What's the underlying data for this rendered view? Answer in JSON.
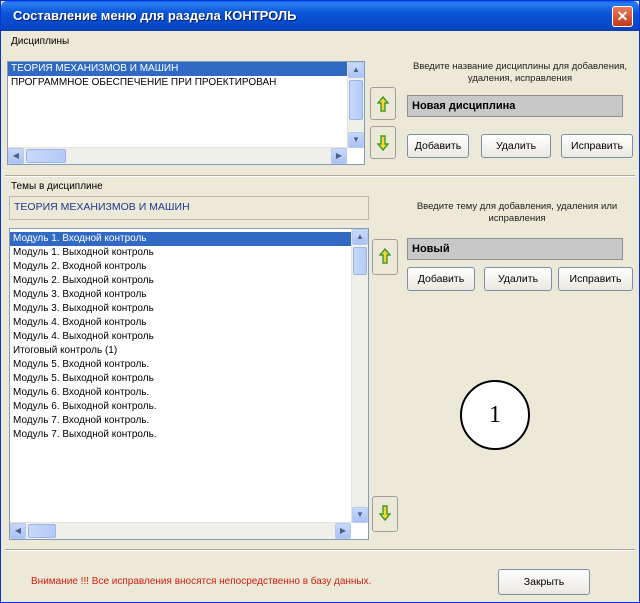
{
  "window": {
    "title": "Составление меню для раздела КОНТРОЛЬ",
    "close_symbol": "✕"
  },
  "disciplines": {
    "group_label": "Дисциплины",
    "items": [
      {
        "label": "ТЕОРИЯ МЕХАНИЗМОВ И МАШИН",
        "selected": true
      },
      {
        "label": "ПРОГРАММНОЕ ОБЕСПЕЧЕНИЕ ПРИ ПРОЕКТИРОВАН",
        "selected": false
      }
    ],
    "hint": "Введите название дисциплины для добавления, удаления, исправления",
    "input_value": "Новая дисциплина",
    "buttons": {
      "add": "Добавить",
      "delete": "Удалить",
      "edit": "Исправить"
    }
  },
  "topics": {
    "group_label": "Темы в дисциплине",
    "current_discipline": "ТЕОРИЯ МЕХАНИЗМОВ И МАШИН",
    "items": [
      {
        "label": "Модуль 1. Входной контроль",
        "selected": true
      },
      {
        "label": "Модуль 1. Выходной контроль",
        "selected": false
      },
      {
        "label": "Модуль 2. Входной контроль",
        "selected": false
      },
      {
        "label": "Модуль 2. Выходной контроль",
        "selected": false
      },
      {
        "label": "Модуль 3. Входной контроль",
        "selected": false
      },
      {
        "label": "Модуль 3. Выходной контроль",
        "selected": false
      },
      {
        "label": "Модуль 4. Входной контроль",
        "selected": false
      },
      {
        "label": "Модуль 4. Выходной контроль",
        "selected": false
      },
      {
        "label": "Итоговый контроль (1)",
        "selected": false
      },
      {
        "label": "Модуль 5. Входной контроль.",
        "selected": false
      },
      {
        "label": "Модуль 5. Выходной контроль",
        "selected": false
      },
      {
        "label": "Модуль 6. Входной контроль.",
        "selected": false
      },
      {
        "label": "Модуль 6. Выходной контроль.",
        "selected": false
      },
      {
        "label": "Модуль 7. Входной контроль.",
        "selected": false
      },
      {
        "label": "Модуль 7. Выходной контроль.",
        "selected": false
      }
    ],
    "hint": "Введите тему для добавления, удаления или исправления",
    "input_value": "Новый",
    "buttons": {
      "add": "Добавить",
      "delete": "Удалить",
      "edit": "Исправить"
    }
  },
  "annotation": {
    "number": "1"
  },
  "footer": {
    "warning": "Внимание !!! Все исправления вносятся непосредственно в базу данных.",
    "close_label": "Закрыть"
  },
  "colors": {
    "selection": "#316ac5",
    "titlebar": "#0a55d8",
    "warning": "#d02010",
    "arrow_green": "#3e9a2a",
    "arrow_yellow": "#f4d637"
  }
}
